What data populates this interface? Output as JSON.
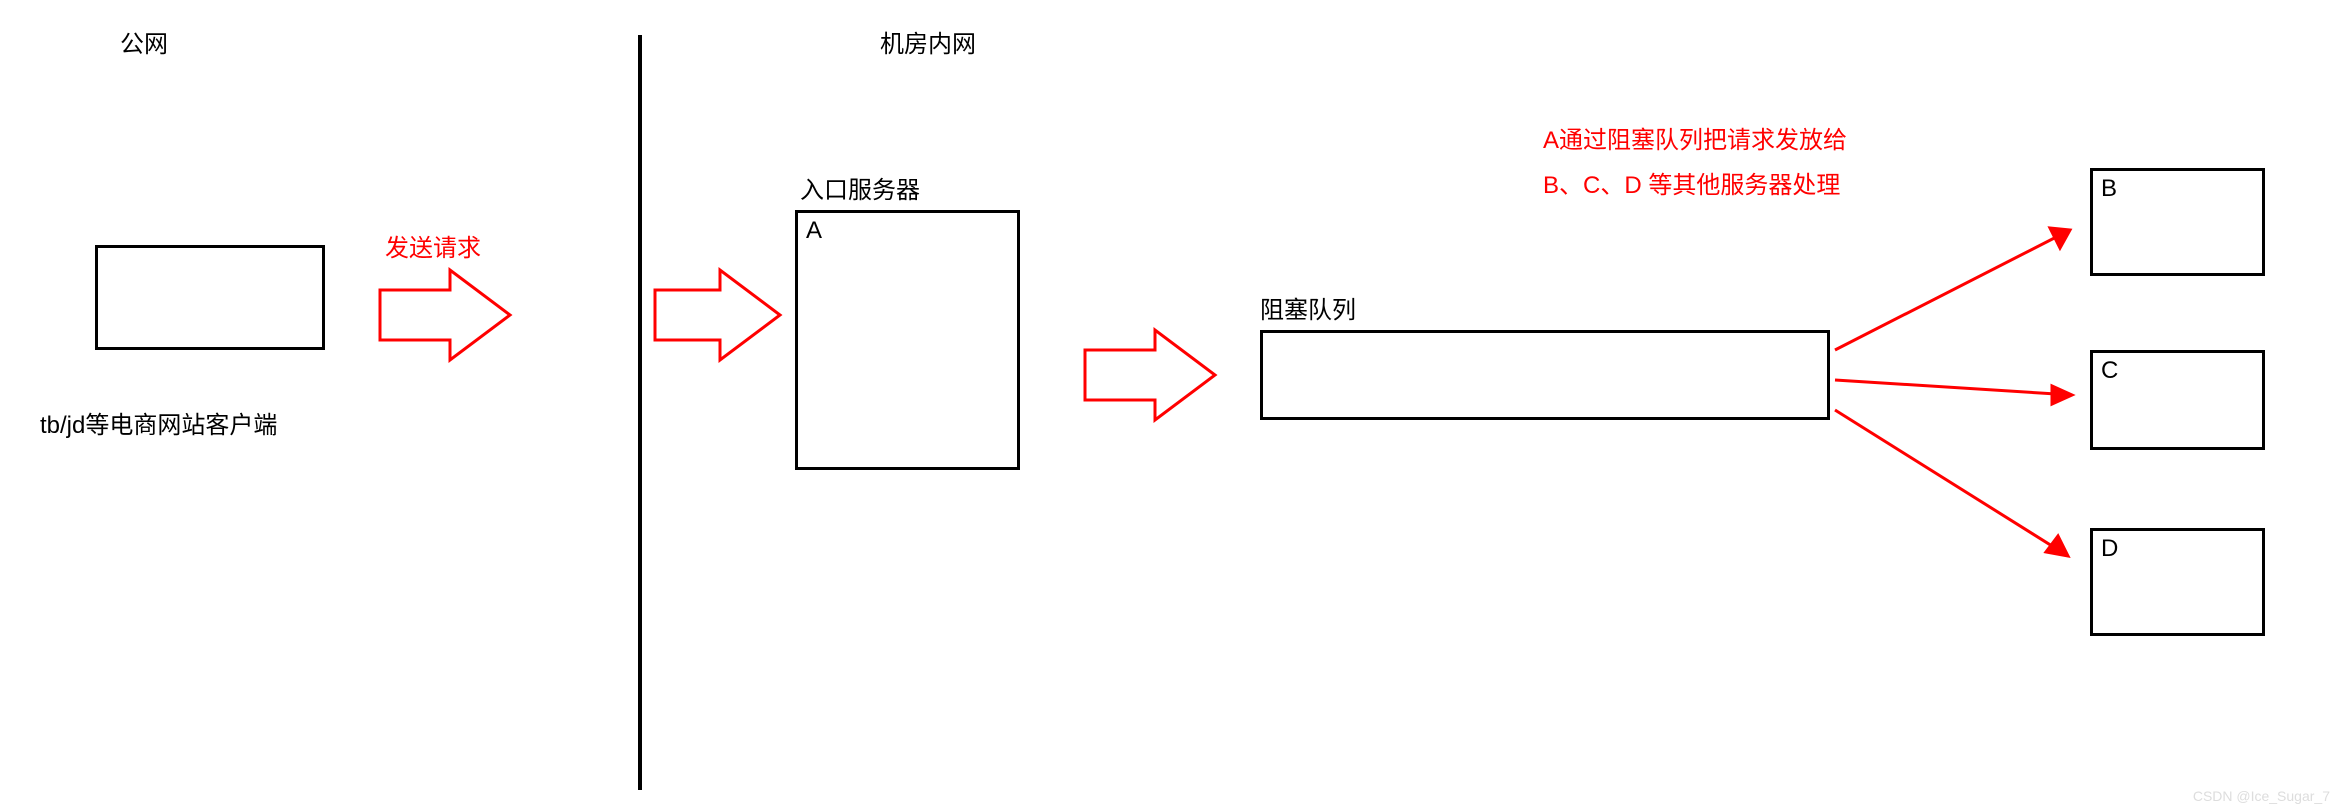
{
  "labels": {
    "public_net": "公网",
    "intranet": "机房内网",
    "client_caption": "tb/jd等电商网站客户端",
    "send_request": "发送请求",
    "entry_server": "入口服务器",
    "blocking_queue": "阻塞队列",
    "distribute_line1": "A通过阻塞队列把请求发放给",
    "distribute_line2": "B、C、D 等其他服务器处理",
    "watermark": "CSDN @Ice_Sugar_7"
  },
  "nodes": {
    "client": {
      "label": ""
    },
    "A": {
      "label": "A"
    },
    "queue": {
      "label": ""
    },
    "B": {
      "label": "B"
    },
    "C": {
      "label": "C"
    },
    "D": {
      "label": "D"
    }
  },
  "colors": {
    "accent": "#ff0000",
    "line": "#000000"
  }
}
